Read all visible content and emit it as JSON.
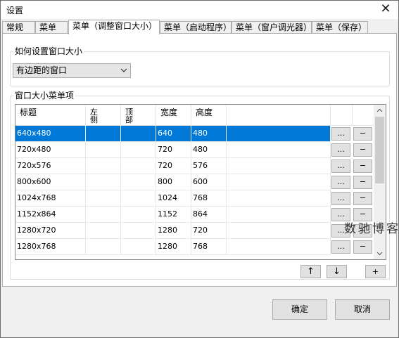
{
  "window": {
    "title": "设置",
    "close_label": "✕"
  },
  "tabs": [
    {
      "label": "常规",
      "active": false
    },
    {
      "label": "菜单",
      "active": false
    },
    {
      "label": "菜单（调整窗口大小）",
      "active": true
    },
    {
      "label": "菜单（启动程序）",
      "active": false
    },
    {
      "label": "菜单（窗户调光器）",
      "active": false
    },
    {
      "label": "菜单（保存）",
      "active": false
    }
  ],
  "size_group": {
    "label": "如何设置窗口大小",
    "select_value": "有边距的窗口"
  },
  "menu_items_group": {
    "label": "窗口大小菜单项",
    "columns": [
      "标题",
      "左侧",
      "顶部",
      "宽度",
      "高度"
    ],
    "rows": [
      {
        "title": "640x480",
        "left": "",
        "top": "",
        "width": "640",
        "height": "480",
        "selected": true
      },
      {
        "title": "720x480",
        "left": "",
        "top": "",
        "width": "720",
        "height": "480",
        "selected": false
      },
      {
        "title": "720x576",
        "left": "",
        "top": "",
        "width": "720",
        "height": "576",
        "selected": false
      },
      {
        "title": "800x600",
        "left": "",
        "top": "",
        "width": "800",
        "height": "600",
        "selected": false
      },
      {
        "title": "1024x768",
        "left": "",
        "top": "",
        "width": "1024",
        "height": "768",
        "selected": false
      },
      {
        "title": "1152x864",
        "left": "",
        "top": "",
        "width": "1152",
        "height": "864",
        "selected": false
      },
      {
        "title": "1280x720",
        "left": "",
        "top": "",
        "width": "1280",
        "height": "720",
        "selected": false
      },
      {
        "title": "1280x768",
        "left": "",
        "top": "",
        "width": "1280",
        "height": "768",
        "selected": false
      }
    ],
    "row_edit_label": "...",
    "row_remove_label": "−",
    "move_up_label": "↑",
    "move_down_label": "↓",
    "add_label": "+"
  },
  "buttons": {
    "ok": "确定",
    "cancel": "取消"
  },
  "watermark": "数驰博客"
}
